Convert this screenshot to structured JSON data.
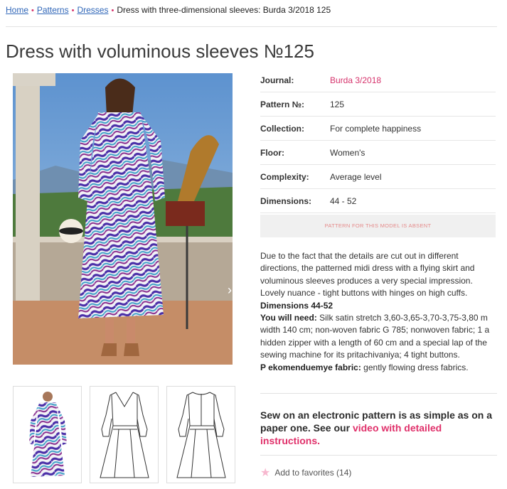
{
  "breadcrumb": {
    "home": "Home",
    "patterns": "Patterns",
    "dresses": "Dresses",
    "current": "Dress with three-dimensional sleeves: Burda 3/2018 125",
    "separator": "•"
  },
  "title": "Dress with voluminous sleeves №125",
  "details": [
    {
      "key": "Journal:",
      "value": "Burda 3/2018",
      "link": true
    },
    {
      "key": "Pattern №:",
      "value": "125",
      "link": false
    },
    {
      "key": "Collection:",
      "value": "For complete happiness",
      "link": false
    },
    {
      "key": "Floor:",
      "value": "Women's",
      "link": false
    },
    {
      "key": "Complexity:",
      "value": "Average level",
      "link": false
    },
    {
      "key": "Dimensions:",
      "value": "44 - 52",
      "link": false
    }
  ],
  "absent_label": "PATTERN FOR THIS MODEL IS ABSENT",
  "description": {
    "intro": "Due to the fact that the details are cut out in different directions, the patterned midi dress with a flying skirt and voluminous sleeves produces a very special impression. Lovely nuance - tight buttons with hinges on high cuffs.",
    "dimensions": "Dimensions 44-52",
    "need_label": "You will need:",
    "need_text": " Silk satin stretch 3,60-3,65-3,70-3,75-3,80 m width 140 cm; non-woven fabric G 785; nonwoven fabric; 1 a hidden zipper with a length of 60 cm and a special lap of the sewing machine for its pritachivaniya; 4 tight buttons.",
    "fabric_label": "P ekomenduemye fabric:",
    "fabric_text": " gently flowing dress fabrics."
  },
  "electronic": {
    "text": "Sew on an electronic pattern is as simple as on a paper one. See our ",
    "link": "video with detailed instructions."
  },
  "favorites": {
    "label": "Add to favorites (14)",
    "icon": "star-icon"
  },
  "photo_nav_icon": "chevron-right-icon",
  "colors": {
    "link": "#2f66b8",
    "accent": "#e0306a",
    "absent_text": "#e58a8a"
  }
}
